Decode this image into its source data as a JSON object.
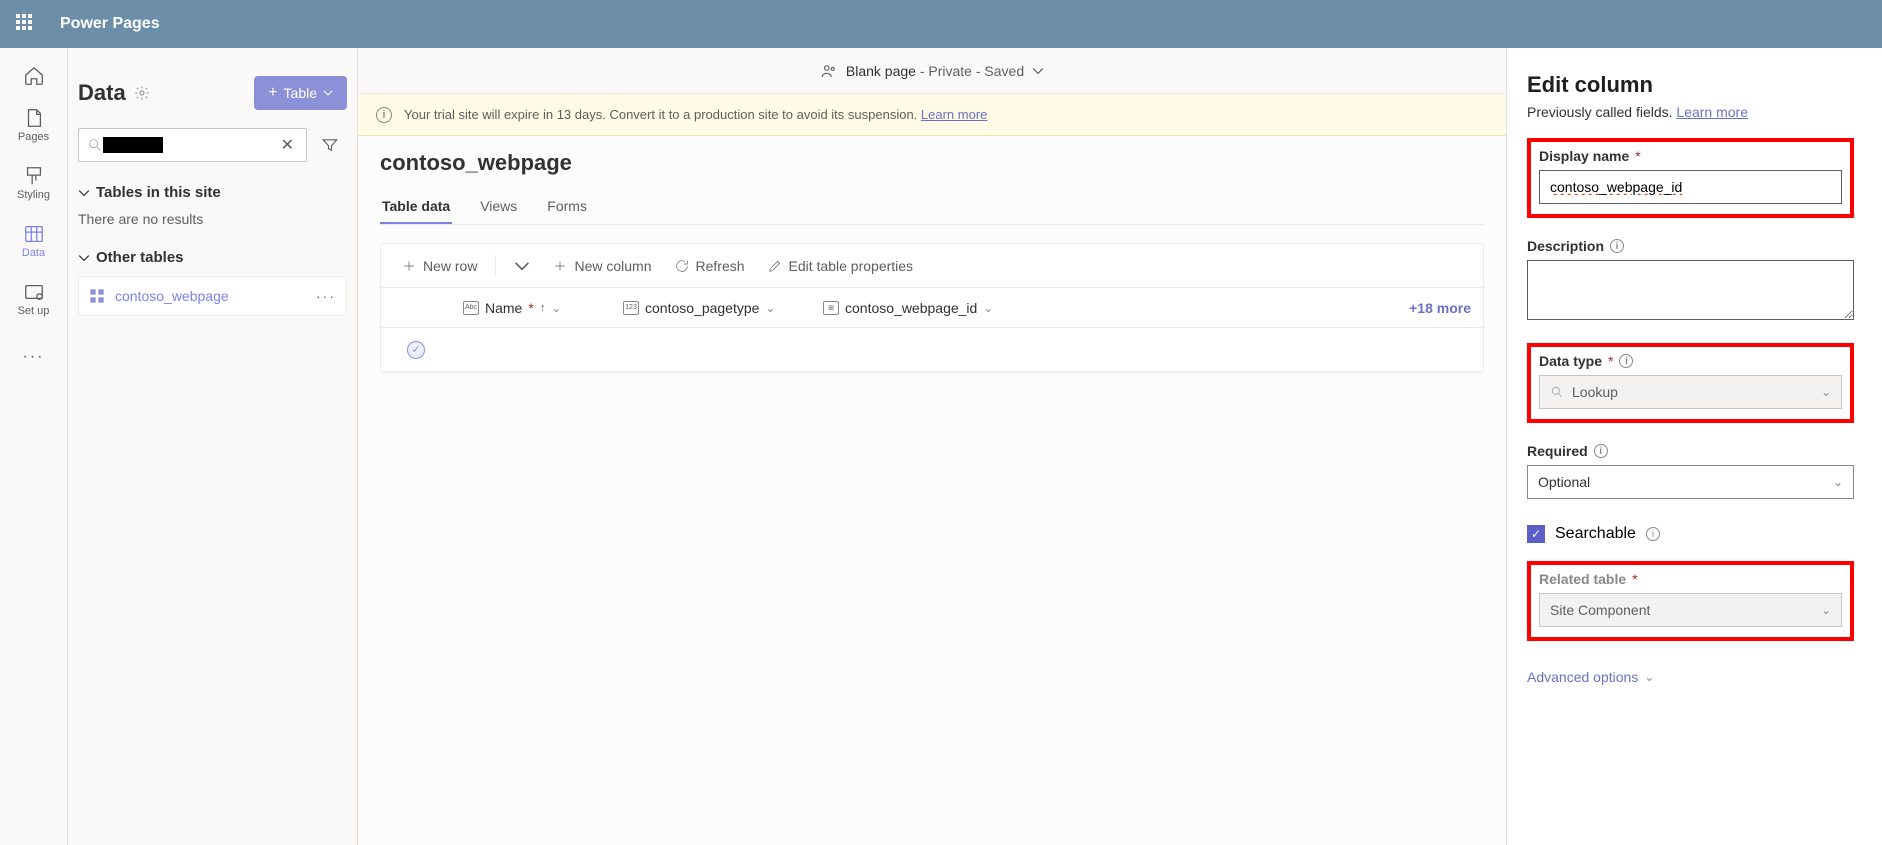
{
  "header": {
    "app": "Power Pages"
  },
  "nav": {
    "pages": "Pages",
    "styling": "Styling",
    "data": "Data",
    "setup": "Set up"
  },
  "crumb": {
    "page": "Blank page",
    "status": " - Private - Saved"
  },
  "banner": {
    "text": "Your trial site will expire in 13 days. Convert it to a production site to avoid its suspension. ",
    "link": "Learn more"
  },
  "sidepanel": {
    "title": "Data",
    "tableBtn": "Table",
    "sec1": "Tables in this site",
    "noResults": "There are no results",
    "sec2": "Other tables",
    "item": "contoso_webpage"
  },
  "content": {
    "tableName": "contoso_webpage",
    "tabs": {
      "data": "Table data",
      "views": "Views",
      "forms": "Forms"
    },
    "toolbar": {
      "newRow": "New row",
      "newCol": "New column",
      "refresh": "Refresh",
      "edit": "Edit table properties"
    },
    "cols": {
      "name": "Name",
      "pagetype": "contoso_pagetype",
      "webpageid": "contoso_webpage_id",
      "more": "+18 more"
    }
  },
  "pane": {
    "title": "Edit column",
    "sub": "Previously called fields. ",
    "learn": "Learn more",
    "displayName": {
      "label": "Display name",
      "value": "contoso_webpage_id"
    },
    "description": {
      "label": "Description"
    },
    "dataType": {
      "label": "Data type",
      "value": "Lookup"
    },
    "required": {
      "label": "Required",
      "value": "Optional"
    },
    "searchable": "Searchable",
    "related": {
      "label": "Related table",
      "value": "Site Component"
    },
    "advanced": "Advanced options"
  }
}
